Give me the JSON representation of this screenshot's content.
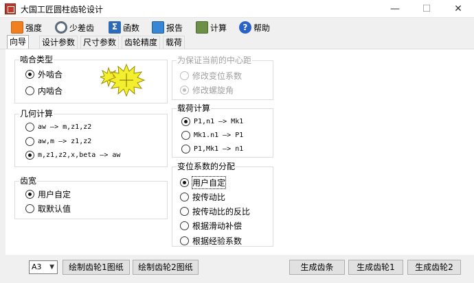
{
  "window": {
    "title": "大国工匠圆柱齿轮设计",
    "min_glyph": "—",
    "max_glyph": "☐",
    "close_glyph": "✕"
  },
  "toolbar": {
    "items": [
      {
        "label": "强度",
        "icon": "strength-icon"
      },
      {
        "label": "少差齿",
        "icon": "gear-icon"
      },
      {
        "label": "函数",
        "icon": "function-icon",
        "glyph": "Σ"
      },
      {
        "label": "报告",
        "icon": "report-icon"
      },
      {
        "label": "计算",
        "icon": "calculator-icon"
      },
      {
        "label": "帮助",
        "icon": "help-icon",
        "glyph": "?"
      }
    ]
  },
  "tabs": [
    {
      "label": "向导",
      "active": true
    },
    {
      "label": "设计参数",
      "active": false
    },
    {
      "label": "尺寸参数",
      "active": false
    },
    {
      "label": "齿轮精度",
      "active": false
    },
    {
      "label": "载荷",
      "active": false
    }
  ],
  "mesh_type": {
    "title": "啮合类型",
    "options": [
      {
        "label": "外啮合",
        "checked": true
      },
      {
        "label": "内啮合",
        "checked": false
      }
    ]
  },
  "center_distance": {
    "title": "为保证当前的中心距",
    "options": [
      {
        "label": "修改变位系数",
        "checked": false
      },
      {
        "label": "修改螺旋角",
        "checked": true
      }
    ],
    "disabled": true
  },
  "geometry": {
    "title": "几何计算",
    "options": [
      {
        "label": "aw —> m,z1,z2",
        "checked": false
      },
      {
        "label": "aw,m —> z1,z2",
        "checked": false
      },
      {
        "label": "m,z1,z2,x,beta —> aw",
        "checked": true
      }
    ]
  },
  "load_calc": {
    "title": "载荷计算",
    "options": [
      {
        "label": "P1,n1 —> Mk1",
        "checked": true
      },
      {
        "label": "Mk1.n1 —> P1",
        "checked": false
      },
      {
        "label": "P1,Mk1 —> n1",
        "checked": false
      }
    ]
  },
  "face_width": {
    "title": "齿宽",
    "options": [
      {
        "label": "用户自定",
        "checked": true
      },
      {
        "label": "取默认值",
        "checked": false
      }
    ]
  },
  "shift_distribution": {
    "title": "变位系数的分配",
    "options": [
      {
        "label": "用户自定",
        "checked": true
      },
      {
        "label": "按传动比",
        "checked": false
      },
      {
        "label": "按传动比的反比",
        "checked": false
      },
      {
        "label": "根据滑动补偿",
        "checked": false
      },
      {
        "label": "根据经验系数",
        "checked": false
      }
    ]
  },
  "bottom": {
    "paper_size": "A3",
    "buttons": {
      "draw_gear1": "绘制齿轮1图纸",
      "draw_gear2": "绘制齿轮2图纸",
      "gen_rack": "生成齿条",
      "gen_gear1": "生成齿轮1",
      "gen_gear2": "生成齿轮2"
    }
  },
  "colors": {
    "accent_sun": "#f4ef2e",
    "sun_outline": "#9a8c00"
  }
}
